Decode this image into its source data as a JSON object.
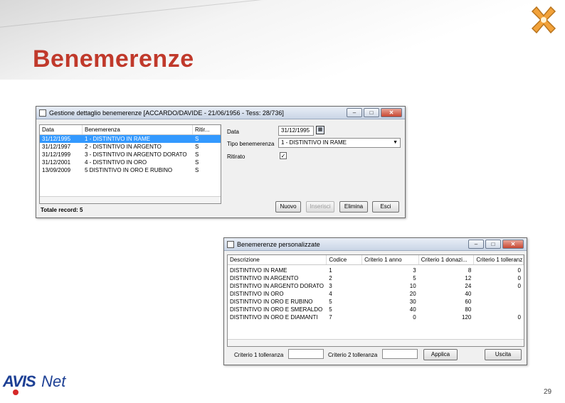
{
  "slide": {
    "title": "Benemerenze",
    "page_number": "29",
    "logo_text_avis": "AVIS",
    "logo_text_net": "Net"
  },
  "win1": {
    "title": "Gestione dettaglio benemerenze [ACCARDO/DAVIDE - 21/06/1956 - Tess: 28/736]",
    "columns": [
      "Data",
      "Benemerenza",
      "Ritir..."
    ],
    "rows": [
      {
        "data": "31/12/1995",
        "benemerenza": "1 - DISTINTIVO IN RAME",
        "ritirato": "S",
        "selected": true
      },
      {
        "data": "31/12/1997",
        "benemerenza": "2 - DISTINTIVO IN ARGENTO",
        "ritirato": "S",
        "selected": false
      },
      {
        "data": "31/12/1999",
        "benemerenza": "3 - DISTINTIVO IN ARGENTO DORATO",
        "ritirato": "S",
        "selected": false
      },
      {
        "data": "31/12/2001",
        "benemerenza": "4 - DISTINTIVO IN ORO",
        "ritirato": "S",
        "selected": false
      },
      {
        "data": "13/09/2009",
        "benemerenza": "5 DISTINTIVO IN ORO E RUBINO",
        "ritirato": "S",
        "selected": false
      }
    ],
    "total_label": "Totale record: 5",
    "form": {
      "data_label": "Data",
      "data_value": "31/12/1995",
      "tipo_label": "Tipo benemerenza",
      "tipo_value": "1 - DISTINTIVO IN RAME",
      "ritirato_label": "Ritirato",
      "ritirato_checked": "✓"
    },
    "buttons": {
      "nuovo": "Nuovo",
      "inserisci": "Inserisci",
      "elimina": "Elimina",
      "esci": "Esci"
    }
  },
  "win2": {
    "title": "Benemerenze personalizzate",
    "columns": [
      "Descrizione",
      "Codice",
      "Criterio 1 anno",
      "Criterio 1 donazi...",
      "Criterio 1 tolleranz..."
    ],
    "rows": [
      {
        "descrizione": "DISTINTIVO IN RAME",
        "codice": "1",
        "anno": "3",
        "donazioni": "8",
        "tolleranza": "0"
      },
      {
        "descrizione": "DISTINTIVO IN ARGENTO",
        "codice": "2",
        "anno": "5",
        "donazioni": "12",
        "tolleranza": "0"
      },
      {
        "descrizione": "DISTINTIVO IN ARGENTO DORATO",
        "codice": "3",
        "anno": "10",
        "donazioni": "24",
        "tolleranza": "0"
      },
      {
        "descrizione": "DISTINTIVO IN ORO",
        "codice": "4",
        "anno": "20",
        "donazioni": "40",
        "tolleranza": ""
      },
      {
        "descrizione": "DISTINTIVO IN ORO E RUBINO",
        "codice": "5",
        "anno": "30",
        "donazioni": "60",
        "tolleranza": ""
      },
      {
        "descrizione": "DISTINTIVO IN ORO E SMERALDO",
        "codice": "5",
        "anno": "40",
        "donazioni": "80",
        "tolleranza": ""
      },
      {
        "descrizione": "DISTINTIVO IN ORO E DIAMANTI",
        "codice": "7",
        "anno": "0",
        "donazioni": "120",
        "tolleranza": "0"
      }
    ],
    "criterio1_label": "Criterio 1 tolleranza",
    "criterio2_label": "Criterio 2 tolleranza",
    "buttons": {
      "applica": "Applica",
      "uscita": "Uscita"
    }
  },
  "colors": {
    "title_red": "#c0392b",
    "selection_blue": "#3399ff"
  }
}
